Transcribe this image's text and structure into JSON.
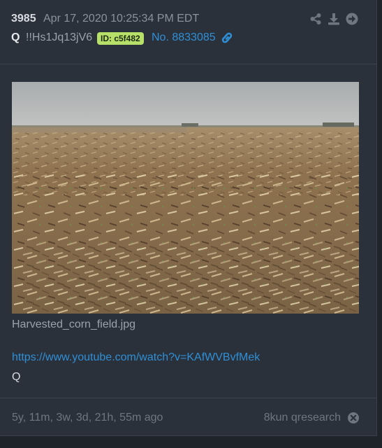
{
  "post": {
    "number": "3985",
    "date": "Apr 17, 2020 10:25:34 PM EDT",
    "author": "Q",
    "tripcode": "!!Hs1Jq13jV6",
    "id_badge": "ID: c5f482",
    "post_no": "No. 8833085",
    "image_filename": "Harvested_corn_field.jpg",
    "link_url": "https://www.youtube.com/watch?v=KAfWVBvfMek",
    "signature": "Q"
  },
  "footer": {
    "ago": "5y, 11m, 3w, 3d, 21h, 55m ago",
    "source": "8kun qresearch"
  },
  "colors": {
    "background": "#1f242b",
    "card": "#2b313a",
    "link": "#2f8fd6",
    "badge": "#b7e06a"
  },
  "icons": {
    "share": "share-icon",
    "download": "download-icon",
    "goto": "arrow-right-circle-icon",
    "link": "link-icon",
    "close": "close-circle-icon"
  }
}
